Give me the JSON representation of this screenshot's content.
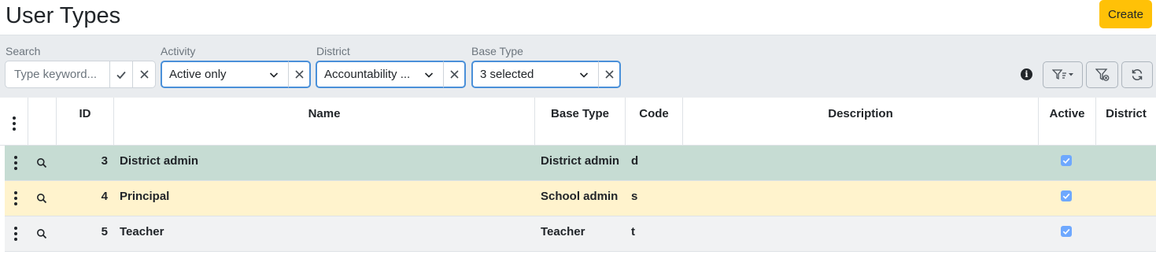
{
  "header": {
    "title": "User Types",
    "create_label": "Create"
  },
  "filters": {
    "search": {
      "label": "Search",
      "placeholder": "Type keyword..."
    },
    "activity": {
      "label": "Activity",
      "value": "Active only"
    },
    "district": {
      "label": "District",
      "value": "Accountability ..."
    },
    "base_type": {
      "label": "Base Type",
      "value": "3 selected"
    }
  },
  "table": {
    "columns": [
      "ID",
      "Name",
      "Base Type",
      "Code",
      "Description",
      "Active",
      "District"
    ],
    "rows": [
      {
        "id": "3",
        "name": "District admin",
        "base_type": "District admin",
        "code": "d",
        "description": "",
        "active": true,
        "district": "",
        "bg": "#c6dcd3"
      },
      {
        "id": "4",
        "name": "Principal",
        "base_type": "School admin",
        "code": "s",
        "description": "",
        "active": true,
        "district": "",
        "bg": "#fff3cd"
      },
      {
        "id": "5",
        "name": "Teacher",
        "base_type": "Teacher",
        "code": "t",
        "description": "",
        "active": true,
        "district": "",
        "bg": "#f1f2f3"
      }
    ]
  },
  "colors": {
    "accent": "#ffc107",
    "focus": "#4a90d9",
    "checkbox": "#6ea8fe"
  }
}
